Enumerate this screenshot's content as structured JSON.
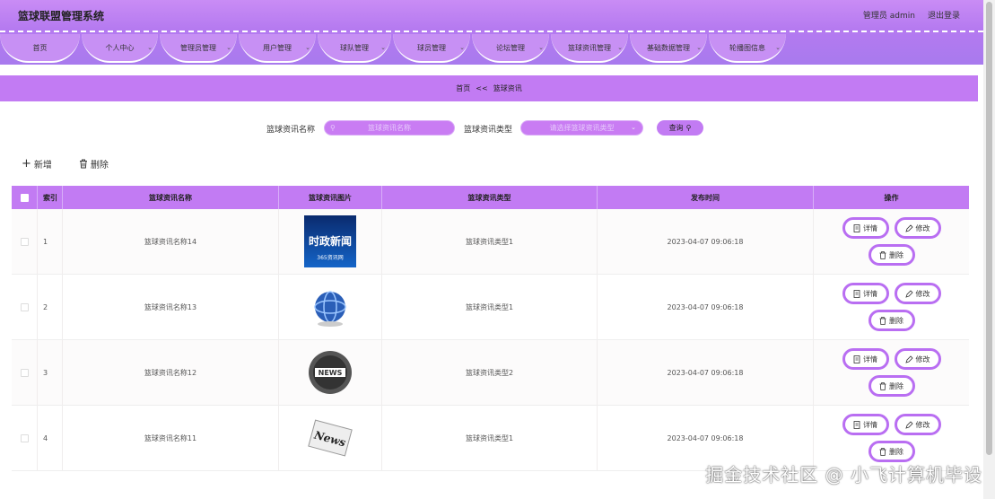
{
  "app": {
    "title": "篮球联盟管理系统",
    "user": "管理员 admin",
    "logout": "退出登录"
  },
  "nav": [
    {
      "label": "首页",
      "has_caret": false
    },
    {
      "label": "个人中心",
      "has_caret": true
    },
    {
      "label": "管理员管理",
      "has_caret": true
    },
    {
      "label": "用户管理",
      "has_caret": true
    },
    {
      "label": "球队管理",
      "has_caret": true
    },
    {
      "label": "球员管理",
      "has_caret": true
    },
    {
      "label": "论坛管理",
      "has_caret": true
    },
    {
      "label": "篮球资讯管理",
      "has_caret": true
    },
    {
      "label": "基础数据管理",
      "has_caret": true
    },
    {
      "label": "轮播图信息",
      "has_caret": true
    }
  ],
  "breadcrumb": {
    "home": "首页",
    "sep": "<<",
    "current": "篮球资讯"
  },
  "search": {
    "name_label": "篮球资讯名称",
    "name_placeholder": "篮球资讯名称",
    "type_label": "篮球资讯类型",
    "type_placeholder": "请选择篮球资讯类型",
    "query_label": "查询"
  },
  "toolbar": {
    "add_label": "新增",
    "delete_label": "删除"
  },
  "table": {
    "headers": [
      "索引",
      "篮球资讯名称",
      "篮球资讯图片",
      "篮球资讯类型",
      "发布时间",
      "操作"
    ],
    "rows": [
      {
        "index": "1",
        "name": "篮球资讯名称14",
        "image": "时政新闻 thumbnail",
        "image_text": "时政新闻",
        "image_subtext": "365资讯网",
        "type": "篮球资讯类型1",
        "time": "2023-04-07 09:06:18"
      },
      {
        "index": "2",
        "name": "篮球资讯名称13",
        "image": "globe thumbnail",
        "type": "篮球资讯类型1",
        "time": "2023-04-07 09:06:18"
      },
      {
        "index": "3",
        "name": "篮球资讯名称12",
        "image": "news-badge thumbnail",
        "image_text": "NEWS",
        "type": "篮球资讯类型2",
        "time": "2023-04-07 09:06:18"
      },
      {
        "index": "4",
        "name": "篮球资讯名称11",
        "image": "newspaper thumbnail",
        "image_text": "News",
        "type": "篮球资讯类型1",
        "time": "2023-04-07 09:06:18"
      }
    ],
    "op_detail": "详情",
    "op_edit": "修改",
    "op_delete": "删除"
  },
  "watermark": "掘金技术社区 @ 小飞计算机毕设",
  "colors": {
    "accent": "#c27bf3",
    "header_gradient_top": "#c98cf5",
    "button_border": "#b96ef2"
  }
}
